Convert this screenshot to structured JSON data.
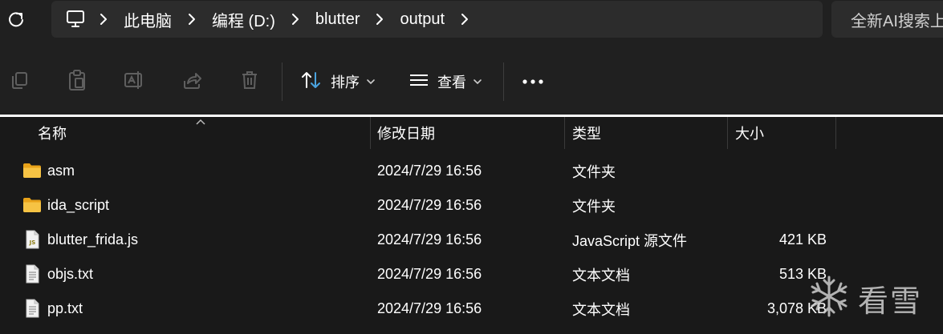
{
  "address_bar": {
    "breadcrumbs": [
      "此电脑",
      "编程 (D:)",
      "blutter",
      "output"
    ],
    "search_placeholder": "全新AI搜索上"
  },
  "toolbar": {
    "sort_label": "排序",
    "view_label": "查看"
  },
  "file_list": {
    "columns": [
      "名称",
      "修改日期",
      "类型",
      "大小"
    ],
    "rows": [
      {
        "name": "asm",
        "modified": "2024/7/29 16:56",
        "type": "文件夹",
        "size": "",
        "icon": "folder-icon"
      },
      {
        "name": "ida_script",
        "modified": "2024/7/29 16:56",
        "type": "文件夹",
        "size": "",
        "icon": "folder-icon"
      },
      {
        "name": "blutter_frida.js",
        "modified": "2024/7/29 16:56",
        "type": "JavaScript 源文件",
        "size": "421 KB",
        "icon": "js-file-icon"
      },
      {
        "name": "objs.txt",
        "modified": "2024/7/29 16:56",
        "type": "文本文档",
        "size": "513 KB",
        "icon": "text-file-icon"
      },
      {
        "name": "pp.txt",
        "modified": "2024/7/29 16:56",
        "type": "文本文档",
        "size": "3,078 KB",
        "icon": "text-file-icon"
      }
    ]
  },
  "watermark": {
    "text": "看雪"
  },
  "colors": {
    "background": "#191919",
    "toolbar": "#202020",
    "address": "#2c2c2c",
    "folder": "#f6c344",
    "accent": "#4aa3df"
  }
}
